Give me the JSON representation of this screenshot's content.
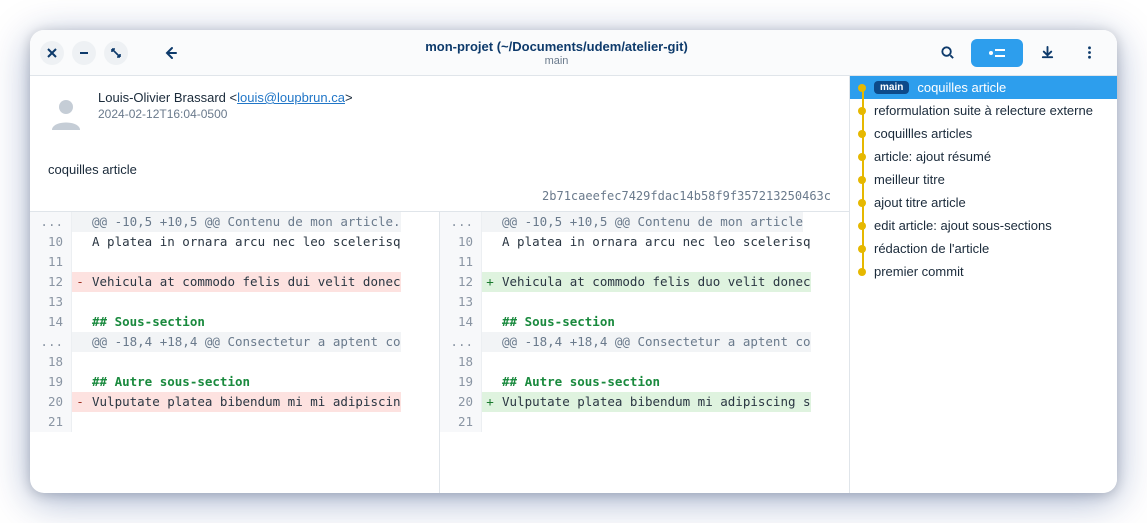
{
  "window": {
    "title": "mon-projet (~/Documents/udem/atelier-git)",
    "branch": "main"
  },
  "commit": {
    "author_name": "Louis-Olivier Brassard",
    "author_email": "louis@loupbrun.ca",
    "date": "2024-02-12T16:04-0500",
    "title": "coquilles article",
    "hash": "2b71caeefec7429fdac14b58f9f357213250463c"
  },
  "diff_left": [
    {
      "ln": "...",
      "cls": "hunk",
      "m": "",
      "txt": "@@ -10,5 +10,5 @@ Contenu de mon article."
    },
    {
      "ln": "10",
      "cls": "",
      "m": "",
      "txt": "A platea in ornara arcu nec leo scelerisq"
    },
    {
      "ln": "11",
      "cls": "",
      "m": "",
      "txt": ""
    },
    {
      "ln": "12",
      "cls": "del",
      "m": "-",
      "txt": "Vehicula at commodo felis dui velit donec"
    },
    {
      "ln": "13",
      "cls": "",
      "m": "",
      "txt": ""
    },
    {
      "ln": "14",
      "cls": "",
      "m": "",
      "txt": "## Sous-section",
      "hd": true
    },
    {
      "ln": "...",
      "cls": "hunk",
      "m": "",
      "txt": "@@ -18,4 +18,4 @@ Consectetur a aptent co"
    },
    {
      "ln": "18",
      "cls": "",
      "m": "",
      "txt": ""
    },
    {
      "ln": "19",
      "cls": "",
      "m": "",
      "txt": "## Autre sous-section",
      "hd": true
    },
    {
      "ln": "20",
      "cls": "del",
      "m": "-",
      "txt": "Vulputate platea bibendum mi mi adipiscin"
    },
    {
      "ln": "21",
      "cls": "",
      "m": "",
      "txt": ""
    }
  ],
  "diff_right": [
    {
      "ln": "...",
      "cls": "hunk",
      "m": "",
      "txt": "@@ -10,5 +10,5 @@ Contenu de mon article"
    },
    {
      "ln": "10",
      "cls": "",
      "m": "",
      "txt": "A platea in ornara arcu nec leo scelerisq"
    },
    {
      "ln": "11",
      "cls": "",
      "m": "",
      "txt": ""
    },
    {
      "ln": "12",
      "cls": "add",
      "m": "+",
      "txt": "Vehicula at commodo felis duo velit donec"
    },
    {
      "ln": "13",
      "cls": "",
      "m": "",
      "txt": ""
    },
    {
      "ln": "14",
      "cls": "",
      "m": "",
      "txt": "## Sous-section",
      "hd": true
    },
    {
      "ln": "...",
      "cls": "hunk",
      "m": "",
      "txt": "@@ -18,4 +18,4 @@ Consectetur a aptent co"
    },
    {
      "ln": "18",
      "cls": "",
      "m": "",
      "txt": ""
    },
    {
      "ln": "19",
      "cls": "",
      "m": "",
      "txt": "## Autre sous-section",
      "hd": true
    },
    {
      "ln": "20",
      "cls": "add",
      "m": "+",
      "txt": "Vulputate platea bibendum mi adipiscing s"
    },
    {
      "ln": "21",
      "cls": "",
      "m": "",
      "txt": ""
    }
  ],
  "history": [
    {
      "msg": "coquilles article",
      "branch": "main",
      "selected": true
    },
    {
      "msg": "reformulation suite à relecture externe"
    },
    {
      "msg": "coquillles articles"
    },
    {
      "msg": "article: ajout résumé"
    },
    {
      "msg": "meilleur titre"
    },
    {
      "msg": "ajout titre article"
    },
    {
      "msg": "edit article: ajout sous-sections"
    },
    {
      "msg": "rédaction de l'article"
    },
    {
      "msg": "premier commit"
    }
  ]
}
